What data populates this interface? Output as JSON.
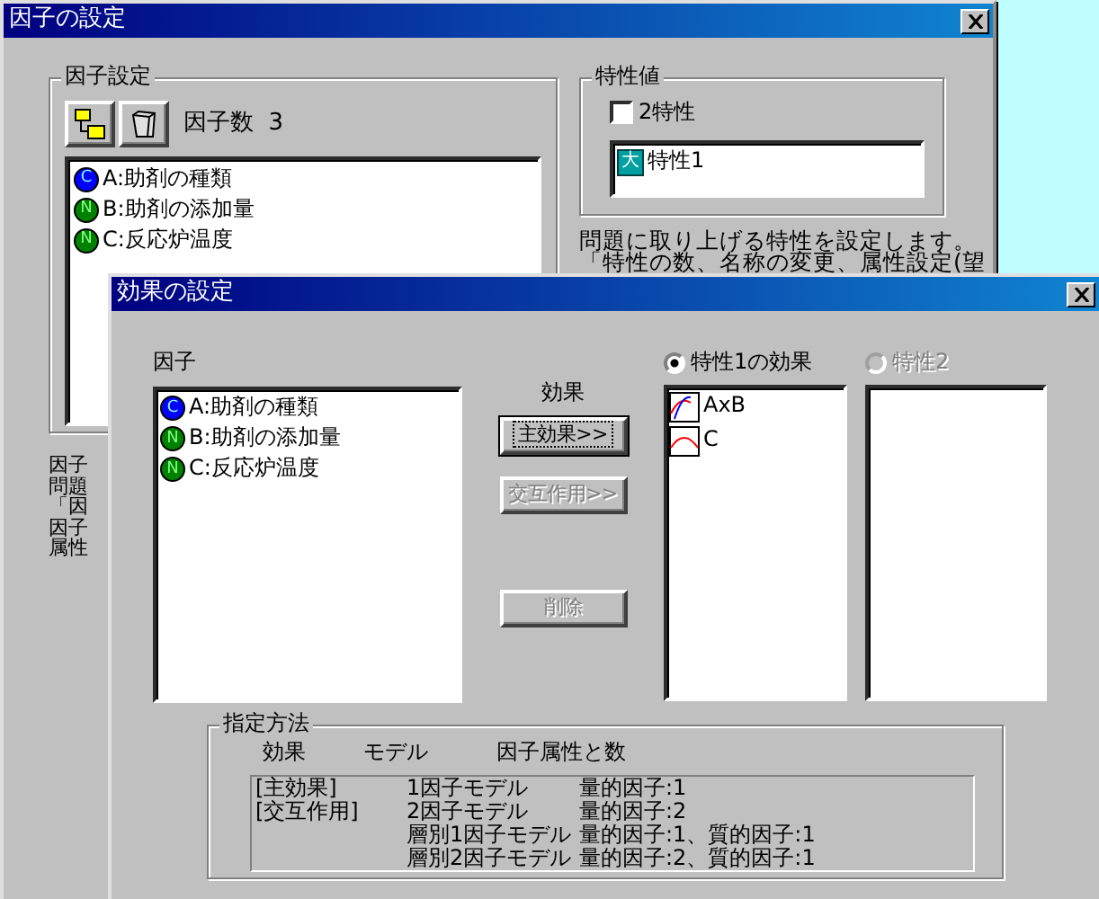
{
  "back_window": {
    "title": "因子の設定",
    "factor_group": {
      "label": "因子設定",
      "count_label": "因子数",
      "count": "3",
      "items": [
        {
          "badge": "C",
          "color": "#0000ff",
          "label": "A:助剤の種類"
        },
        {
          "badge": "N",
          "color": "#008000",
          "label": "B:助剤の添加量"
        },
        {
          "badge": "N",
          "color": "#008000",
          "label": "C:反応炉温度"
        }
      ]
    },
    "factor_help": [
      "因子",
      "問題",
      "「因",
      "因子",
      "属性"
    ],
    "trait_group": {
      "label": "特性値",
      "checkbox": {
        "label": "2特性",
        "checked": false
      },
      "items": [
        {
          "badge": "大",
          "label": "特性1"
        }
      ]
    },
    "trait_help": [
      "問題に取り上げる特性を設定します。",
      "「特性の数、名称の変更、属性設定(望"
    ]
  },
  "dialog": {
    "title": "効果の設定",
    "factor_label": "因子",
    "factors": [
      {
        "badge": "C",
        "color": "#0000ff",
        "label": "A:助剤の種類"
      },
      {
        "badge": "N",
        "color": "#008000",
        "label": "B:助剤の添加量"
      },
      {
        "badge": "N",
        "color": "#008000",
        "label": "C:反応炉温度"
      }
    ],
    "effect_label": "効果",
    "buttons": [
      {
        "label": "主効果>>",
        "disabled": false,
        "focused": true
      },
      {
        "label": "交互作用>>",
        "disabled": true,
        "focused": false
      },
      {
        "label": "削除",
        "disabled": true,
        "focused": false
      }
    ],
    "radios": [
      {
        "label": "特性1の効果",
        "selected": true,
        "disabled": false
      },
      {
        "label": "特性2",
        "selected": false,
        "disabled": true
      }
    ],
    "trait1_effects": [
      {
        "label": "AxB",
        "kind": "interaction"
      },
      {
        "label": "C",
        "kind": "main"
      }
    ],
    "method": {
      "label": "指定方法",
      "headers": [
        "効果",
        "モデル",
        "因子属性と数"
      ],
      "rows": [
        {
          "effect": "[主効果]",
          "model": "1因子モデル",
          "attributes": "量的因子:1"
        },
        {
          "effect": "[交互作用]",
          "model": "2因子モデル",
          "attributes": "量的因子:2"
        },
        {
          "model": "層別1因子モデル",
          "attributes": "量的因子:1、質的因子:1"
        },
        {
          "model": "層別2因子モデル",
          "attributes": "量的因子:2、質的因子:1"
        }
      ]
    }
  }
}
